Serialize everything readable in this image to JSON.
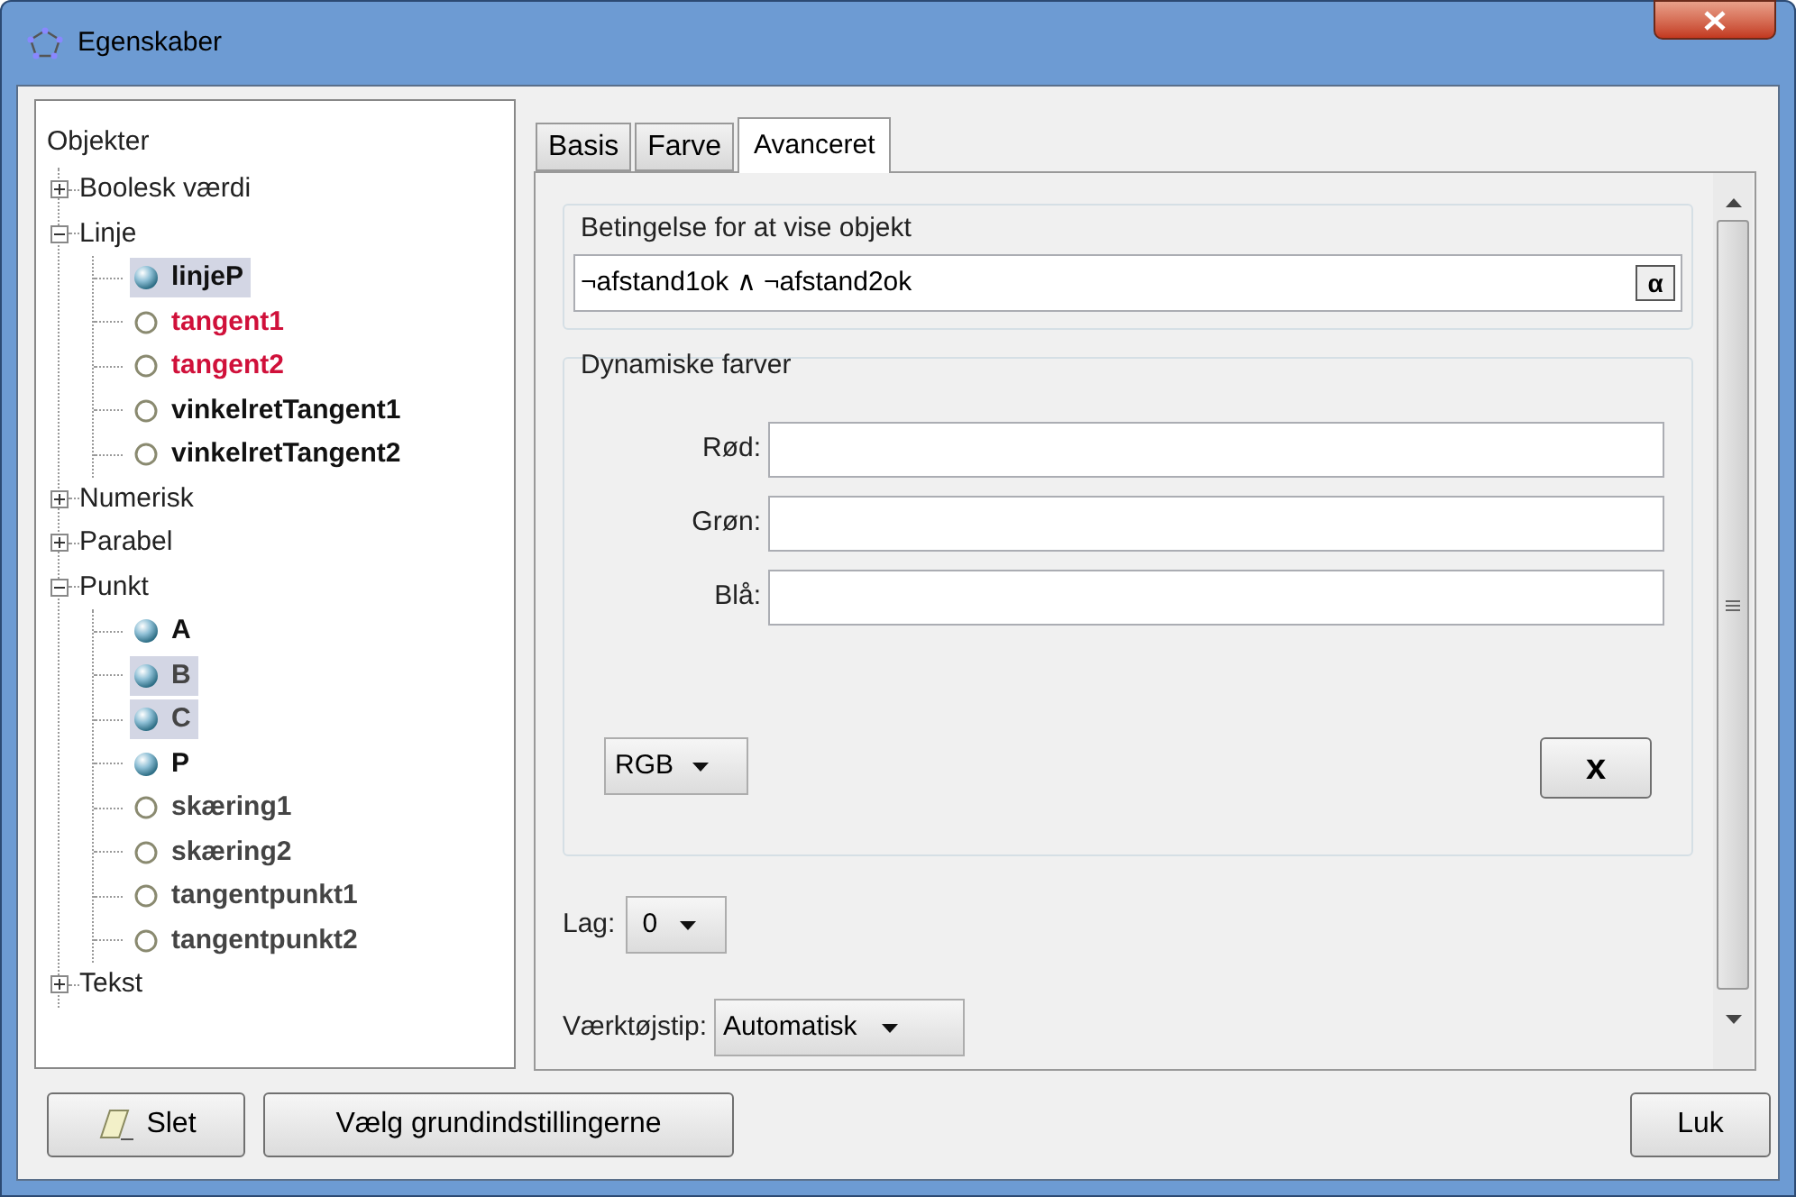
{
  "window": {
    "title": "Egenskaber"
  },
  "tree": {
    "root": "Objekter",
    "children": [
      {
        "kind": "category",
        "label": "Boolesk værdi",
        "expanded": false
      },
      {
        "kind": "category",
        "label": "Linje",
        "expanded": true,
        "children": [
          {
            "kind": "object",
            "label": "linjeP",
            "visible": true,
            "selected": true,
            "color": "#111111"
          },
          {
            "kind": "object",
            "label": "tangent1",
            "visible": false,
            "selected": false,
            "color": "#d0103a"
          },
          {
            "kind": "object",
            "label": "tangent2",
            "visible": false,
            "selected": false,
            "color": "#d0103a"
          },
          {
            "kind": "object",
            "label": "vinkelretTangent1",
            "visible": false,
            "selected": false,
            "color": "#111111"
          },
          {
            "kind": "object",
            "label": "vinkelretTangent2",
            "visible": false,
            "selected": false,
            "color": "#111111"
          }
        ]
      },
      {
        "kind": "category",
        "label": "Numerisk",
        "expanded": false
      },
      {
        "kind": "category",
        "label": "Parabel",
        "expanded": false
      },
      {
        "kind": "category",
        "label": "Punkt",
        "expanded": true,
        "children": [
          {
            "kind": "object",
            "label": "A",
            "visible": true,
            "selected": false,
            "color": "#111111"
          },
          {
            "kind": "object",
            "label": "B",
            "visible": true,
            "selected": true,
            "color": "#444444"
          },
          {
            "kind": "object",
            "label": "C",
            "visible": true,
            "selected": true,
            "color": "#444444"
          },
          {
            "kind": "object",
            "label": "P",
            "visible": true,
            "selected": false,
            "color": "#111111"
          },
          {
            "kind": "object",
            "label": "skæring1",
            "visible": false,
            "selected": false,
            "color": "#444444"
          },
          {
            "kind": "object",
            "label": "skæring2",
            "visible": false,
            "selected": false,
            "color": "#444444"
          },
          {
            "kind": "object",
            "label": "tangentpunkt1",
            "visible": false,
            "selected": false,
            "color": "#444444"
          },
          {
            "kind": "object",
            "label": "tangentpunkt2",
            "visible": false,
            "selected": false,
            "color": "#444444"
          }
        ]
      },
      {
        "kind": "category",
        "label": "Tekst",
        "expanded": false
      }
    ]
  },
  "tabs": [
    {
      "label": "Basis",
      "selected": false
    },
    {
      "label": "Farve",
      "selected": false
    },
    {
      "label": "Avanceret",
      "selected": true
    }
  ],
  "condition": {
    "title": "Betingelse for at vise objekt",
    "value": "¬afstand1ok ∧ ¬afstand2ok",
    "symbol_button": "α"
  },
  "dynamic_colors": {
    "title": "Dynamiske farver",
    "fields": [
      {
        "label": "Rød:"
      },
      {
        "label": "Grøn:"
      },
      {
        "label": "Blå:"
      }
    ],
    "mode": "RGB",
    "clear_button": "x"
  },
  "layer": {
    "label": "Lag:",
    "value": "0"
  },
  "tooltip": {
    "label": "Værktøjstip:",
    "value": "Automatisk"
  },
  "buttons": {
    "delete": "Slet",
    "defaults": "Vælg grundindstillingerne",
    "close": "Luk"
  }
}
